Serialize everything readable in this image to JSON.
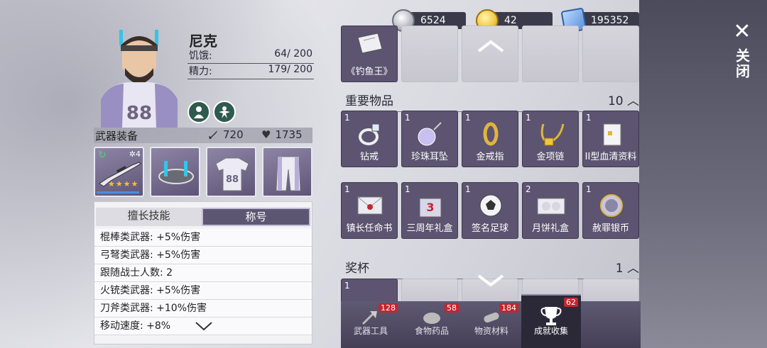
{
  "currency": [
    {
      "icon": "silver-coin-icon",
      "value": "6524"
    },
    {
      "icon": "gold-coin-icon",
      "value": "42"
    },
    {
      "icon": "ticket-icon",
      "value": "195352"
    }
  ],
  "close_label": "关闭",
  "character": {
    "name": "尼克",
    "hunger_label": "饥饿:",
    "hunger_value": "64/ 200",
    "energy_label": "精力:",
    "energy_value": "179/ 200"
  },
  "weapons": {
    "title": "武器装备",
    "attack": "720",
    "health": "1735",
    "weapon_level": "4"
  },
  "skills": {
    "tab_skills": "擅长技能",
    "tab_title": "称号",
    "rows": [
      "棍棒类武器: +5%伤害",
      "弓弩类武器: +5%伤害",
      "跟随战士人数: 2",
      "火铳类武器: +5%伤害",
      "刀斧类武器: +10%伤害",
      "移动速度: +8%"
    ]
  },
  "top_item": {
    "name": "《钓鱼王》"
  },
  "important": {
    "title": "重要物品",
    "count": "10",
    "items": [
      {
        "qty": "1",
        "name": "钻戒"
      },
      {
        "qty": "1",
        "name": "珍珠耳坠"
      },
      {
        "qty": "1",
        "name": "金戒指"
      },
      {
        "qty": "1",
        "name": "金项链"
      },
      {
        "qty": "1",
        "name": "II型血清资料"
      },
      {
        "qty": "1",
        "name": "镇长任命书"
      },
      {
        "qty": "1",
        "name": "三周年礼盒"
      },
      {
        "qty": "1",
        "name": "签名足球"
      },
      {
        "qty": "2",
        "name": "月饼礼盒"
      },
      {
        "qty": "1",
        "name": "赦罪银币"
      }
    ]
  },
  "trophy": {
    "title": "奖杯",
    "count": "1",
    "qty": "1"
  },
  "nav": [
    {
      "label": "武器工具",
      "count": "128"
    },
    {
      "label": "食物药品",
      "count": "58"
    },
    {
      "label": "物资材料",
      "count": "184"
    },
    {
      "label": "成就收集",
      "count": "62"
    }
  ],
  "colors": {
    "accent": "#5c5470",
    "badge": "#c1272d",
    "star": "#f6c22d"
  }
}
